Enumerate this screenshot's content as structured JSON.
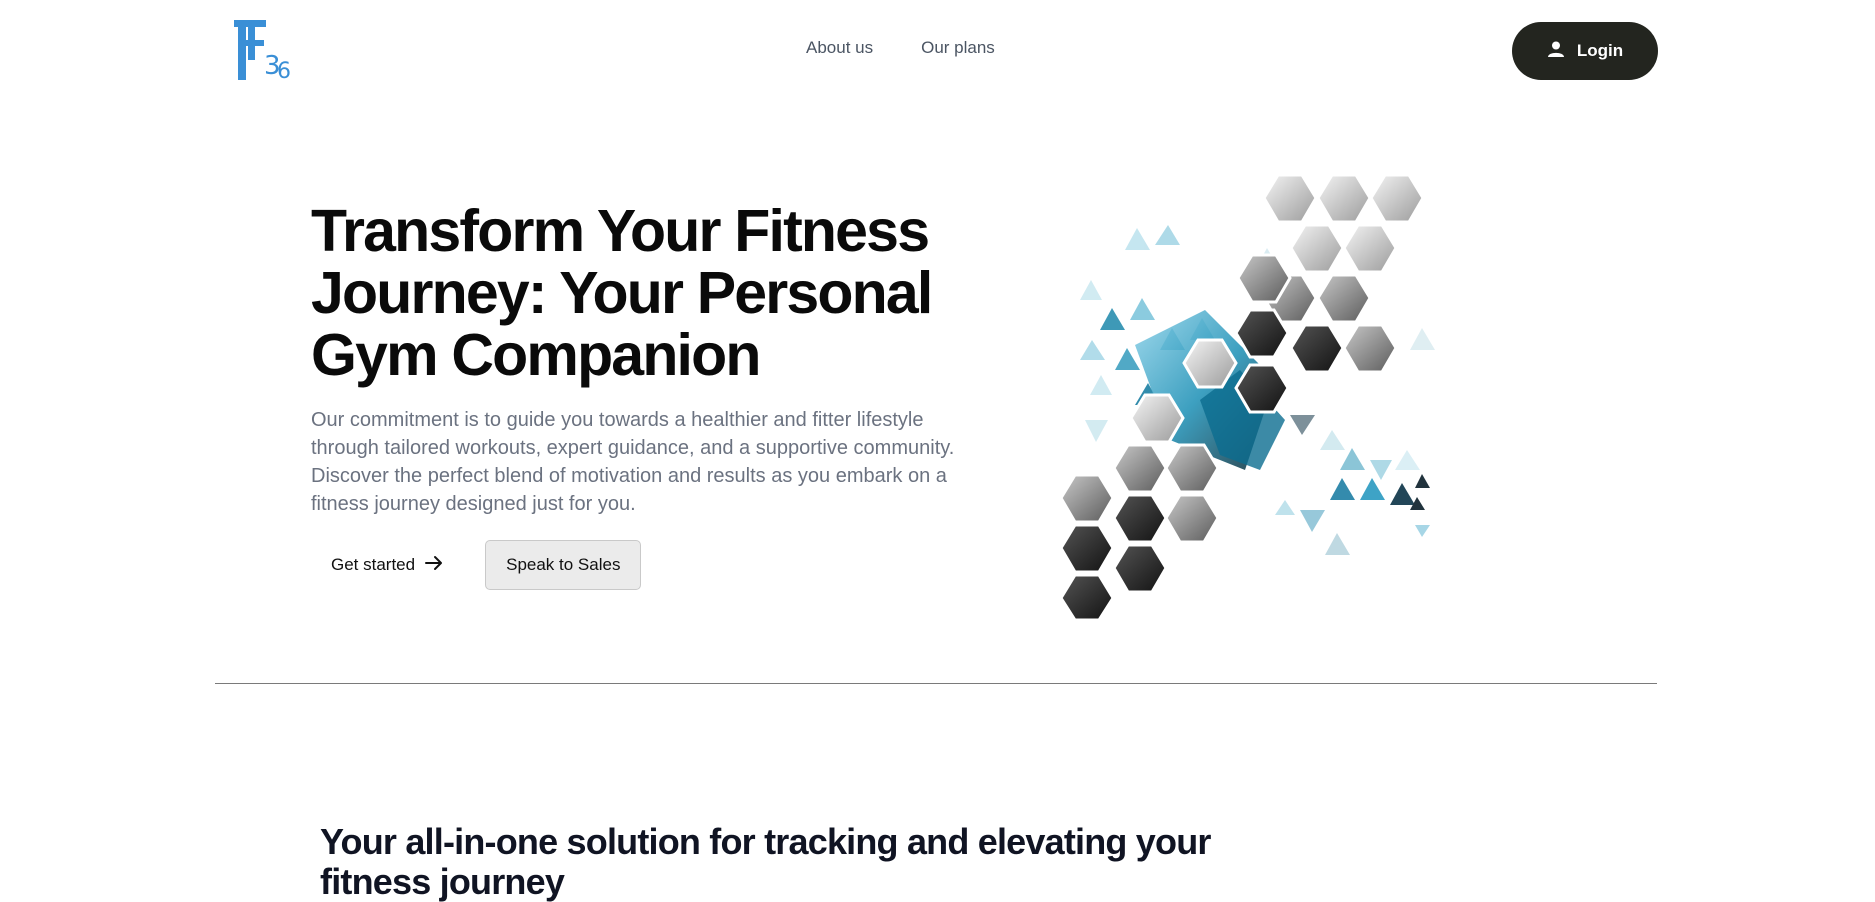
{
  "header": {
    "logo_text": "F36",
    "nav": [
      {
        "label": "About us"
      },
      {
        "label": "Our plans"
      }
    ],
    "login_label": "Login"
  },
  "hero": {
    "title_lines": [
      "Transform Your Fitness",
      "Journey: Your Personal",
      "Gym Companion"
    ],
    "description": "Our commitment is to guide you towards a healthier and fitter lifestyle through tailored workouts, expert guidance, and a supportive community. Discover the perfect blend of motivation and results as you embark on a fitness journey designed just for you.",
    "get_started_label": "Get started",
    "speak_sales_label": "Speak to Sales"
  },
  "section": {
    "title": "Your all-in-one solution for tracking and elevating your fitness journey"
  },
  "colors": {
    "brand_blue": "#3a8fd6",
    "login_bg": "#23251f",
    "muted_text": "#6b7280",
    "teal": "#1f8fb0"
  },
  "icons": {
    "logo": "f36-logo",
    "user": "user-icon",
    "arrow": "arrow-right-icon"
  }
}
